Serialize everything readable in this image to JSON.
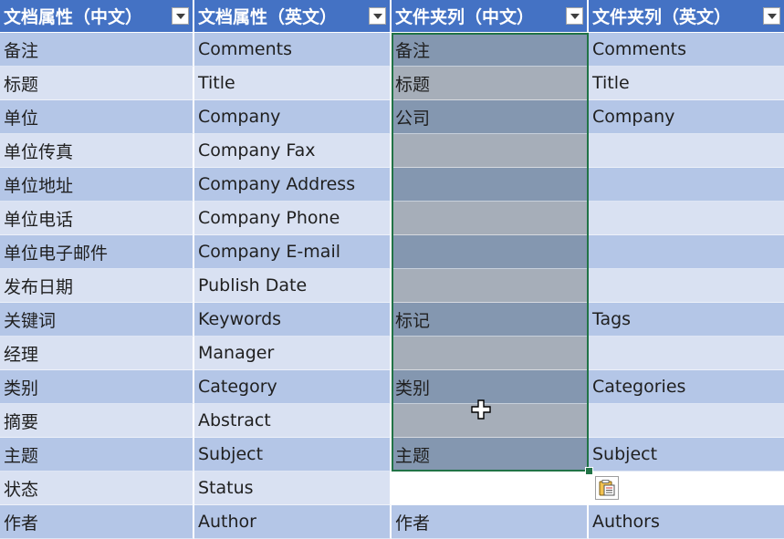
{
  "headers": [
    "文档属性（中文）",
    "文档属性（英文）",
    "文件夹列（中文）",
    "文件夹列（英文）"
  ],
  "rows": [
    [
      "备注",
      "Comments",
      "备注",
      "Comments"
    ],
    [
      "标题",
      "Title",
      "标题",
      "Title"
    ],
    [
      "单位",
      "Company",
      "公司",
      "Company"
    ],
    [
      "单位传真",
      "Company Fax",
      "",
      ""
    ],
    [
      "单位地址",
      "Company Address",
      "",
      ""
    ],
    [
      "单位电话",
      "Company Phone",
      "",
      ""
    ],
    [
      "单位电子邮件",
      "Company E-mail",
      "",
      ""
    ],
    [
      "发布日期",
      "Publish Date",
      "",
      ""
    ],
    [
      "关键词",
      "Keywords",
      "标记",
      "Tags"
    ],
    [
      "经理",
      "Manager",
      "",
      ""
    ],
    [
      "类别",
      "Category",
      "类别",
      "Categories"
    ],
    [
      "摘要",
      "Abstract",
      "",
      ""
    ],
    [
      "主题",
      "Subject",
      "主题",
      "Subject"
    ],
    [
      "状态",
      "Status",
      "",
      ""
    ],
    [
      "作者",
      "Author",
      "作者",
      "Authors"
    ]
  ],
  "icons": {
    "filter_dropdown": "chevron-down-icon",
    "paste_options": "paste-options-icon",
    "cursor": "cross-cursor-icon"
  },
  "colors": {
    "header_bg": "#4472c4",
    "band_dark": "#b4c6e7",
    "band_light": "#d9e1f2",
    "selection_border": "#217346",
    "selected_dark": "#8497b0",
    "selected_light": "#a6aeb9"
  }
}
